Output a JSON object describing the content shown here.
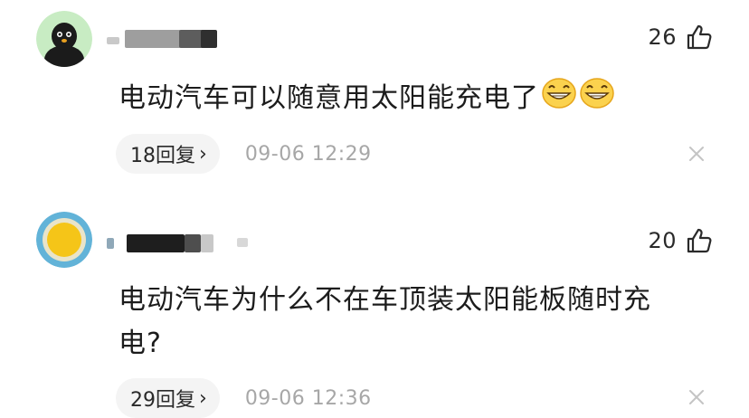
{
  "comments": [
    {
      "likes": "26",
      "text": "电动汽车可以随意用太阳能充电了",
      "replies": "18回复",
      "reply_arrow": "›",
      "time": "09-06 12:29",
      "avatar_icon": "penguin-avatar-icon",
      "emoji_icon": "grinning-face-icon"
    },
    {
      "likes": "20",
      "text": "电动汽车为什么不在车顶装太阳能板随时充电?",
      "replies": "29回复",
      "reply_arrow": "›",
      "time": "09-06 12:36",
      "avatar_icon": "sun-avatar-icon"
    }
  ],
  "colors": {
    "avatar1_bg": "#c8ecc3",
    "avatar2_ring": "#62b3d8",
    "avatar2_sun": "#f5c518",
    "reply_bg": "#f4f4f4",
    "time_text": "#a7a7a7",
    "close_icon": "#c4c4c4"
  }
}
